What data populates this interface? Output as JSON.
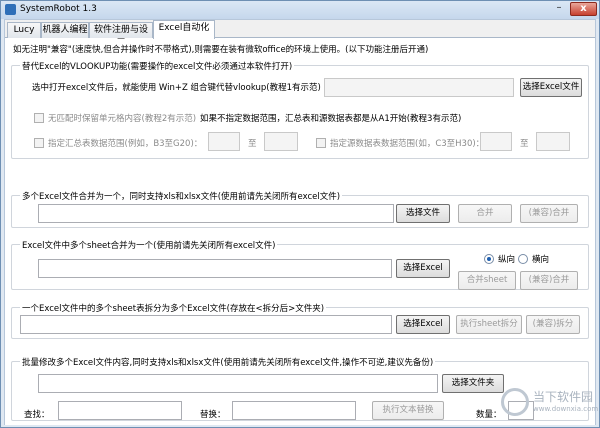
{
  "window": {
    "title": "SystemRobot 1.3",
    "minimize": "–",
    "close": "x"
  },
  "tabs": [
    {
      "label": "Lucy"
    },
    {
      "label": "机器人编程"
    },
    {
      "label": "软件注册与设置"
    },
    {
      "label": "Excel自动化"
    }
  ],
  "active_tab": "Excel自动化",
  "notice": "如无注明\"兼容\"(速度快,但合并操作时不带格式),则需要在装有微软office的环境上使用。(以下功能注册后开通)",
  "vlookup": {
    "title": "替代Excel的VLOOKUP功能(需要操作的excel文件必须通过本软件打开)",
    "desc": "选中打开excel文件后，就能使用 Win+Z 组合键代替vlookup(教程1有示范)",
    "select_button": "选择Excel文件",
    "keep_unmatched": "无匹配时保留单元格内容(教程2有示范)",
    "range_note": "如果不指定数据范围，汇总表和源数据表都是从A1开始(教程3有示范)",
    "summary_range": "指定汇总表数据范围(例如，B3至G20)：",
    "to1": "至",
    "source_range": "指定源数据表数据范围(如，C3至H30)：",
    "to2": "至"
  },
  "merge_files": {
    "title": "多个Excel文件合并为一个，同时支持xls和xlsx文件(使用前请先关闭所有excel文件)",
    "select_button": "选择文件",
    "merge_button": "合并",
    "compat_merge_button": "(兼容)合并"
  },
  "merge_sheets": {
    "title": "Excel文件中多个sheet合并为一个(使用前请先关闭所有excel文件)",
    "select_button": "选择Excel",
    "radio_vertical": "纵向",
    "radio_horizontal": "横向",
    "merge_sheet_button": "合并sheet",
    "compat_merge_button": "(兼容)合并"
  },
  "split_sheets": {
    "title": "一个Excel文件中的多个sheet表拆分为多个Excel文件(存放在<拆分后>文件夹)",
    "select_button": "选择Excel",
    "split_button": "执行sheet拆分",
    "compat_split_button": "(兼容)拆分"
  },
  "batch_replace": {
    "title": "批量修改多个Excel文件内容,同时支持xls和xlsx文件(使用前请先关闭所有excel文件,操作不可逆,建议先备份)",
    "select_folder_button": "选择文件夹",
    "find_label": "查找：",
    "replace_label": "替换：",
    "execute_button": "执行文本替换",
    "count_label": "数量："
  },
  "watermark": {
    "line1": "当下软件园",
    "line2": "www.downxia.com"
  }
}
